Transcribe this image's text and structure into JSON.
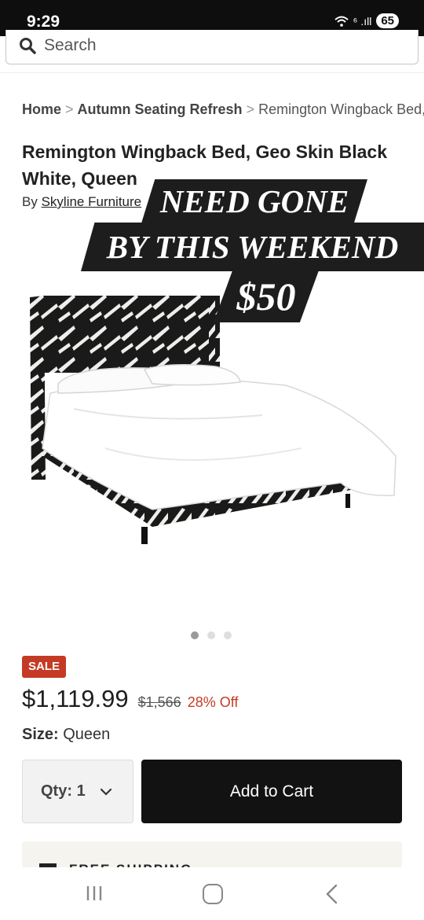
{
  "status_bar": {
    "time": "9:29",
    "signal": "⁶ .ıll",
    "battery": "65"
  },
  "search": {
    "placeholder": "Search"
  },
  "breadcrumb": {
    "home": "Home",
    "category": "Autumn Seating Refresh",
    "current": "Remington Wingback Bed, Geo Skin Black White, Queen"
  },
  "product": {
    "title": "Remington Wingback Bed, Geo Skin Black White, Queen",
    "by_prefix": "By",
    "brand": "Skyline Furniture",
    "sale_badge": "SALE",
    "price": "$1,119.99",
    "original_price": "$1,566",
    "discount": "28% Off",
    "size_label": "Size:",
    "size_value": "Queen",
    "image_count": 3,
    "active_image": 1
  },
  "overlay": {
    "line1": "NEED GONE",
    "line2": "BY THIS WEEKEND",
    "line3": "$50"
  },
  "purchase": {
    "qty_label": "Qty:",
    "qty_value": "1",
    "add_to_cart": "Add to Cart"
  },
  "shipping": {
    "label": "FREE SHIPPING"
  },
  "colors": {
    "sale_red": "#c53a25",
    "button_black": "#121212",
    "banner_black": "#1d1d1d"
  }
}
